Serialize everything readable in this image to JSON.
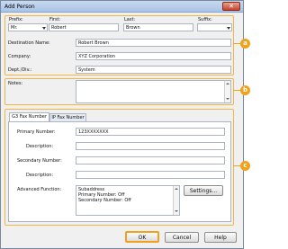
{
  "window": {
    "title": "Add Person",
    "close_glyph": "✕"
  },
  "person": {
    "prefix": {
      "label": "Prefix:",
      "value": "Mr."
    },
    "first": {
      "label": "First:",
      "value": "Robert"
    },
    "last": {
      "label": "Last:",
      "value": "Brown"
    },
    "suffix": {
      "label": "Suffix:",
      "value": ""
    },
    "destination": {
      "label": "Destination Name:",
      "value": "Robert Brown"
    },
    "company": {
      "label": "Company:",
      "value": "XYZ Corporation"
    },
    "dept": {
      "label": "Dept./Div.:",
      "value": "System"
    }
  },
  "notes": {
    "label": "Notes:",
    "value": ""
  },
  "tabs": [
    {
      "label": "G3 Fax Number"
    },
    {
      "label": "IP Fax Number"
    }
  ],
  "fax": {
    "primary": {
      "label": "Primary Number:",
      "value": "123XXXXXXX"
    },
    "primary_desc": {
      "label": "Description:",
      "value": ""
    },
    "secondary": {
      "label": "Secondary Number:",
      "value": ""
    },
    "secondary_desc": {
      "label": "Description:",
      "value": ""
    },
    "advanced": {
      "label": "Advanced Function:",
      "lines": [
        "Subaddress",
        "Primary Number:      Off",
        "Secondary Number: Off"
      ]
    },
    "settings_label": "Settings..."
  },
  "badges": {
    "a": "a",
    "b": "b",
    "c": "c"
  },
  "buttons": {
    "ok": "OK",
    "cancel": "Cancel",
    "help": "Help"
  },
  "colors": {
    "accent": "#f0a21a",
    "panel_border": "#f3b53f"
  },
  "icons": {
    "close": "close-icon",
    "dropdown": "chevron-down-icon",
    "scroll_up": "scroll-up-arrow-icon",
    "scroll_down": "scroll-down-arrow-icon"
  }
}
